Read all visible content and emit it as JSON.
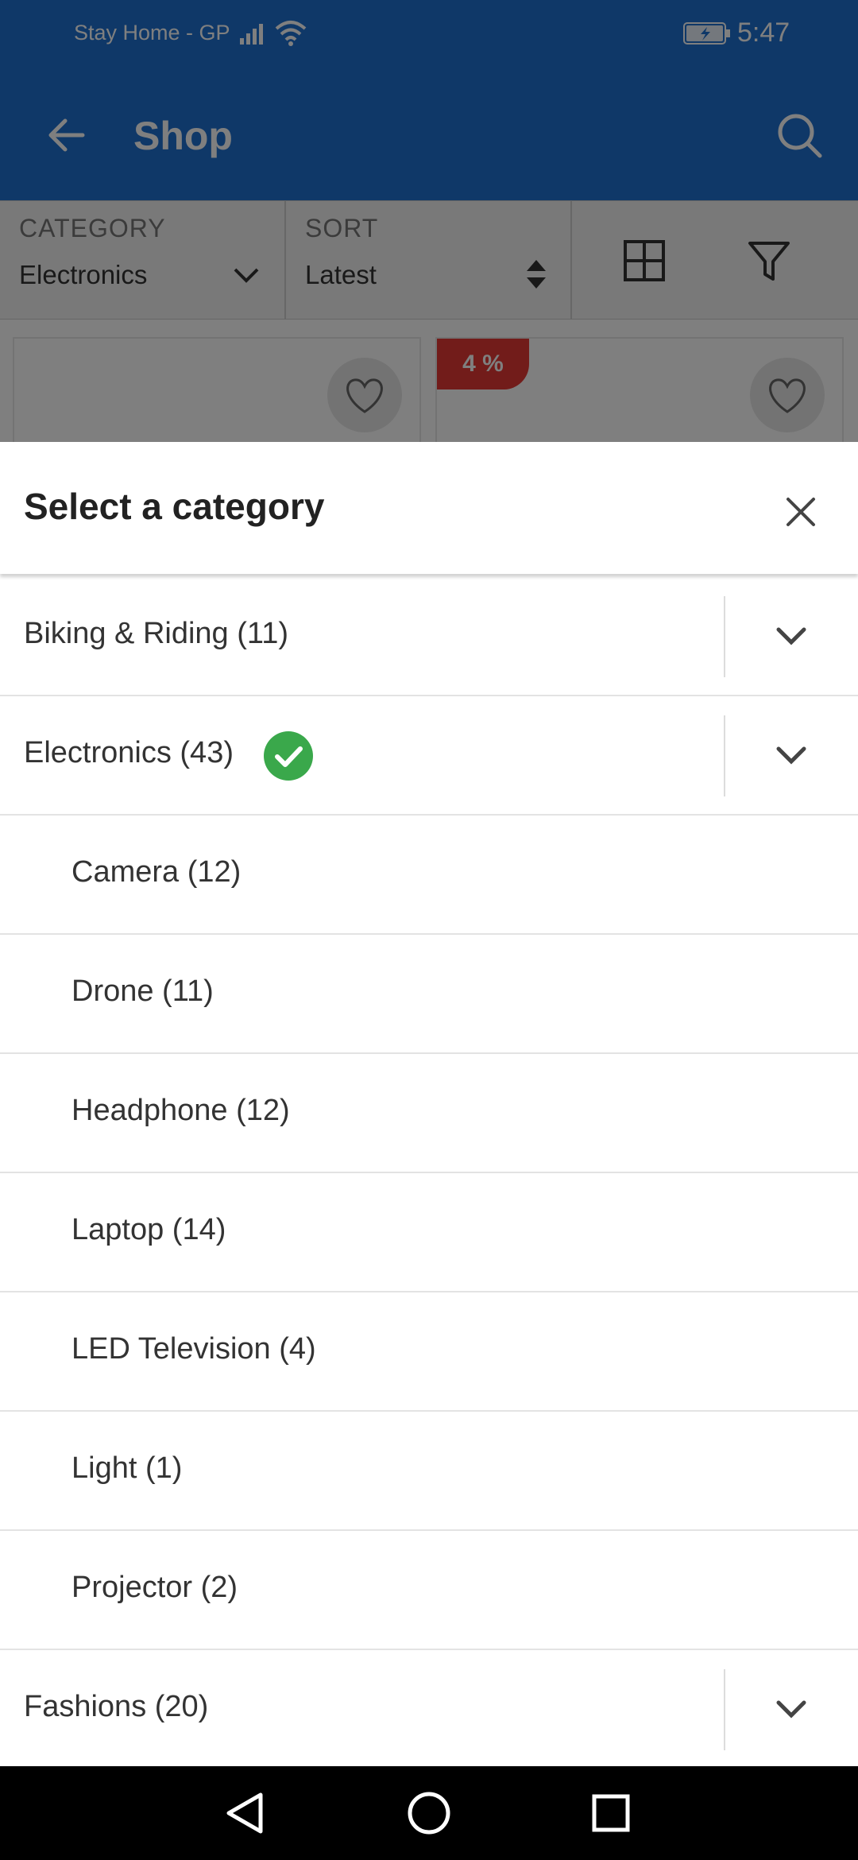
{
  "status_bar": {
    "carrier": "Stay Home - GP",
    "time": "5:47",
    "signal_icon": "signal-icon",
    "wifi_icon": "wifi-icon",
    "battery_icon": "battery-charging-icon"
  },
  "app_bar": {
    "title": "Shop",
    "back_icon": "arrow-back-icon",
    "search_icon": "search-icon",
    "color": "#1e71d1"
  },
  "filters": {
    "category_label": "CATEGORY",
    "category_value": "Electronics",
    "sort_label": "SORT",
    "sort_value": "Latest",
    "grid_icon": "grid-view-icon",
    "filter_icon": "filter-icon"
  },
  "products": {
    "discount_badge": "4 %"
  },
  "sheet": {
    "title": "Select a category",
    "close_icon": "close-icon",
    "categories": [
      {
        "label": "Biking & Riding (11)",
        "expandable": true
      },
      {
        "label": "Electronics (43)",
        "expandable": true,
        "selected": true
      },
      {
        "label": "Camera (12)",
        "sub": true
      },
      {
        "label": "Drone (11)",
        "sub": true
      },
      {
        "label": "Headphone (12)",
        "sub": true
      },
      {
        "label": "Laptop (14)",
        "sub": true
      },
      {
        "label": "LED Television (4)",
        "sub": true
      },
      {
        "label": "Light (1)",
        "sub": true
      },
      {
        "label": "Projector (2)",
        "sub": true
      },
      {
        "label": "Fashions (20)",
        "expandable": true
      }
    ],
    "selected_color": "#3aa84b"
  },
  "nav_bar": {
    "back_icon": "nav-back-icon",
    "home_icon": "nav-home-icon",
    "recents_icon": "nav-recents-icon"
  }
}
